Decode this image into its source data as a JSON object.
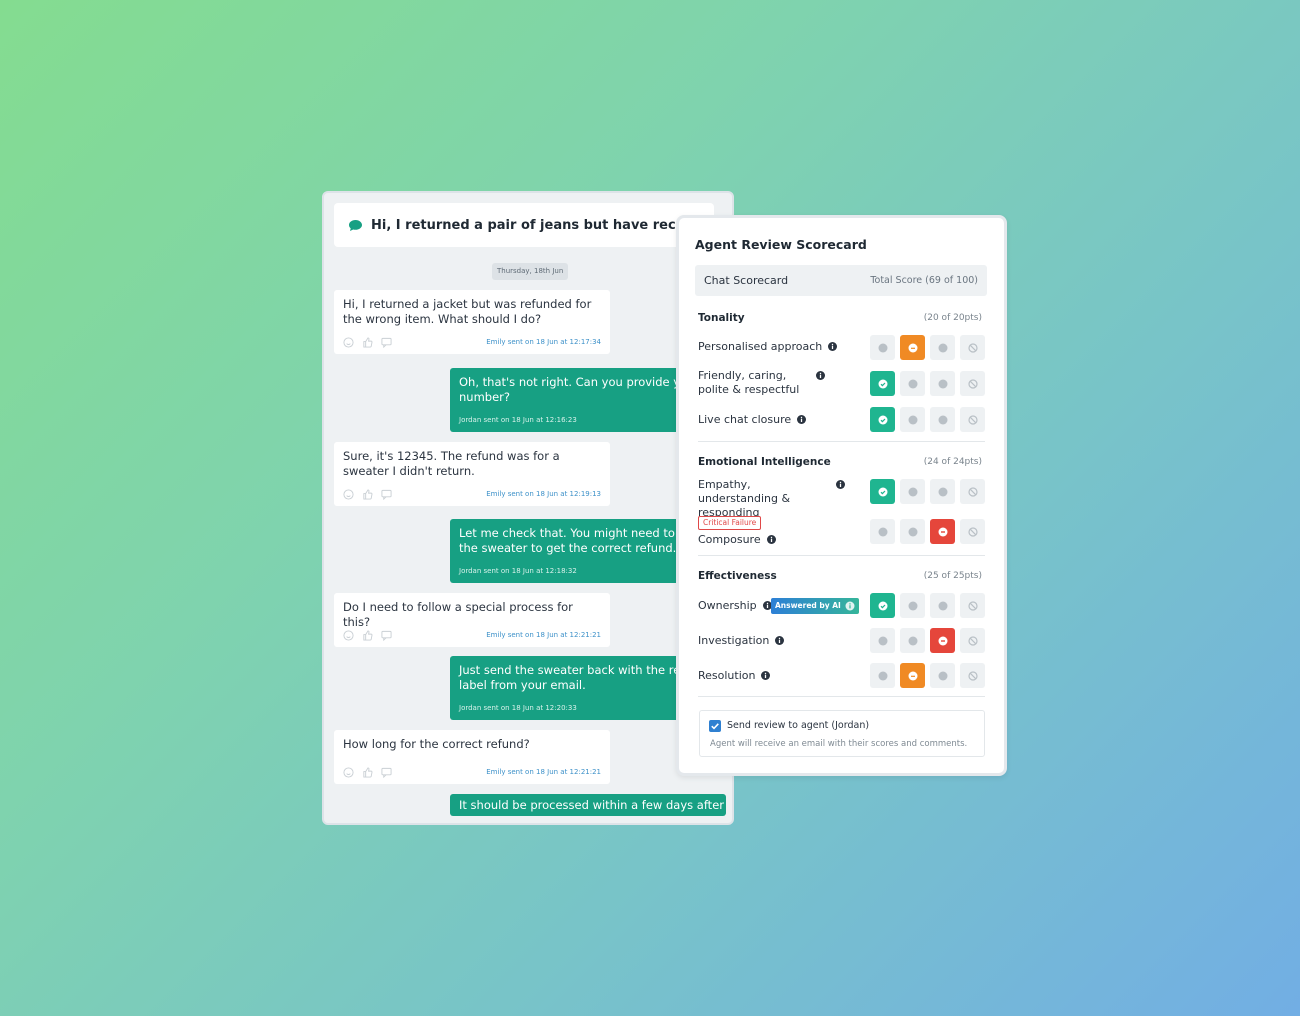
{
  "chat": {
    "title": "Hi, I returned a pair of jeans but have received a",
    "date_divider": "Thursday, 18th Jun",
    "messages": [
      {
        "direction": "in",
        "text": "Hi, I returned a jacket but was refunded for the wrong item. What should I do?",
        "meta": "Emily sent on 18 Jun at 12:17:34"
      },
      {
        "direction": "out",
        "lines": [
          "Oh, that's not right. Can you provide you",
          "number?"
        ],
        "meta": "Jordan sent on 18 Jun at 12:16:23"
      },
      {
        "direction": "in",
        "text": "Sure, it's 12345. The refund was for a sweater I didn't return.",
        "meta": "Emily sent on 18 Jun at 12:19:13"
      },
      {
        "direction": "out",
        "lines": [
          "Let me check that. You might need to re",
          "the sweater to get the correct refund."
        ],
        "meta": "Jordan sent on 18 Jun at 12:18:32"
      },
      {
        "direction": "in",
        "text": "Do I need to follow a special process for this?",
        "meta": "Emily sent on 18 Jun at 12:21:21"
      },
      {
        "direction": "out",
        "lines": [
          "Just send the sweater back with the retu",
          "label from your email."
        ],
        "meta": "Jordan sent on 18 Jun at 12:20:33"
      },
      {
        "direction": "in",
        "text": "How long for the correct refund?",
        "meta": "Emily sent on 18 Jun at 12:21:21"
      },
      {
        "direction": "out",
        "lines": [
          "It should be processed within a few days after"
        ],
        "meta": ""
      }
    ]
  },
  "scorecard": {
    "title": "Agent Review Scorecard",
    "bar_label": "Chat Scorecard",
    "total_score": "Total Score (69 of 100)",
    "sections": [
      {
        "name": "Tonality",
        "points": "(20 of 20pts)",
        "criteria": [
          {
            "label": "Personalised approach",
            "selected": 2,
            "color": "orange"
          },
          {
            "label": "Friendly, caring, polite & respectful",
            "selected": 1,
            "color": "green"
          },
          {
            "label": "Live chat closure",
            "selected": 1,
            "color": "green"
          }
        ]
      },
      {
        "name": "Emotional Intelligence",
        "points": "(24 of 24pts)",
        "criteria": [
          {
            "label": "Empathy, understanding & responding",
            "selected": 1,
            "color": "green"
          },
          {
            "label": "Composure",
            "selected": 3,
            "color": "red",
            "tag": "Critical Failure"
          }
        ]
      },
      {
        "name": "Effectiveness",
        "points": "(25 of 25pts)",
        "criteria": [
          {
            "label": "Ownership",
            "selected": 1,
            "color": "green",
            "badge": "Answered by AI"
          },
          {
            "label": "Investigation",
            "selected": 3,
            "color": "red"
          },
          {
            "label": "Resolution",
            "selected": 2,
            "color": "orange"
          }
        ]
      }
    ],
    "send_review": {
      "checked": true,
      "label": "Send review to agent (Jordan)",
      "hint": "Agent will receive an email with their scores and comments."
    }
  },
  "colors": {
    "green": "#1fb590",
    "orange": "#f08a24",
    "red": "#e5463b",
    "chat_out": "#17a083",
    "timestamp_blue": "#3d91c9"
  }
}
